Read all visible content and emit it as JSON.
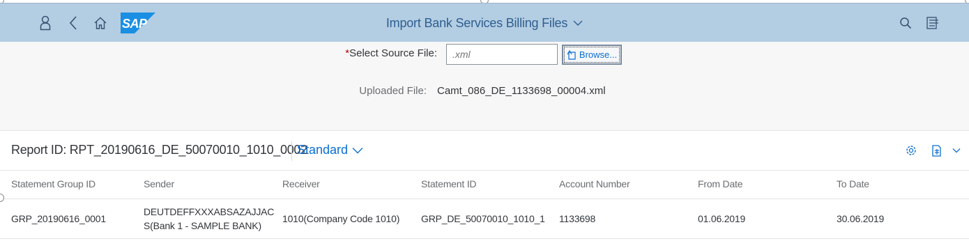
{
  "shell": {
    "title": "Import Bank Services Billing Files",
    "logo_text": "SAP",
    "icons": [
      "user-icon",
      "back-icon",
      "home-icon",
      "search-icon",
      "notifications-menu-icon"
    ]
  },
  "upload": {
    "source_label": "Select Source File:",
    "required_marker": "*",
    "source_placeholder": ".xml",
    "browse_label": "Browse...",
    "uploaded_label": "Uploaded File:",
    "uploaded_value": "Camt_086_DE_1133698_00004.xml"
  },
  "toolbar": {
    "report_title": "Report ID: RPT_20190616_DE_50070010_1010_0002",
    "variant": "Standard"
  },
  "table": {
    "columns": [
      "Statement Group ID",
      "Sender",
      "Receiver",
      "Statement ID",
      "Account Number",
      "From Date",
      "To Date"
    ],
    "rows": [
      {
        "statement_group_id": "GRP_20190616_0001",
        "sender": "DEUTDEFFXXXABSAZAJJACS(Bank 1 - SAMPLE BANK)",
        "receiver": "1010(Company Code 1010)",
        "statement_id": "GRP_DE_50070010_1010_1",
        "account_number": "1133698",
        "from_date": "01.06.2019",
        "to_date": "30.06.2019"
      }
    ]
  },
  "colors": {
    "shell_bg": "#b3cde3",
    "accent": "#0a6ed1",
    "required": "#bb0000"
  }
}
